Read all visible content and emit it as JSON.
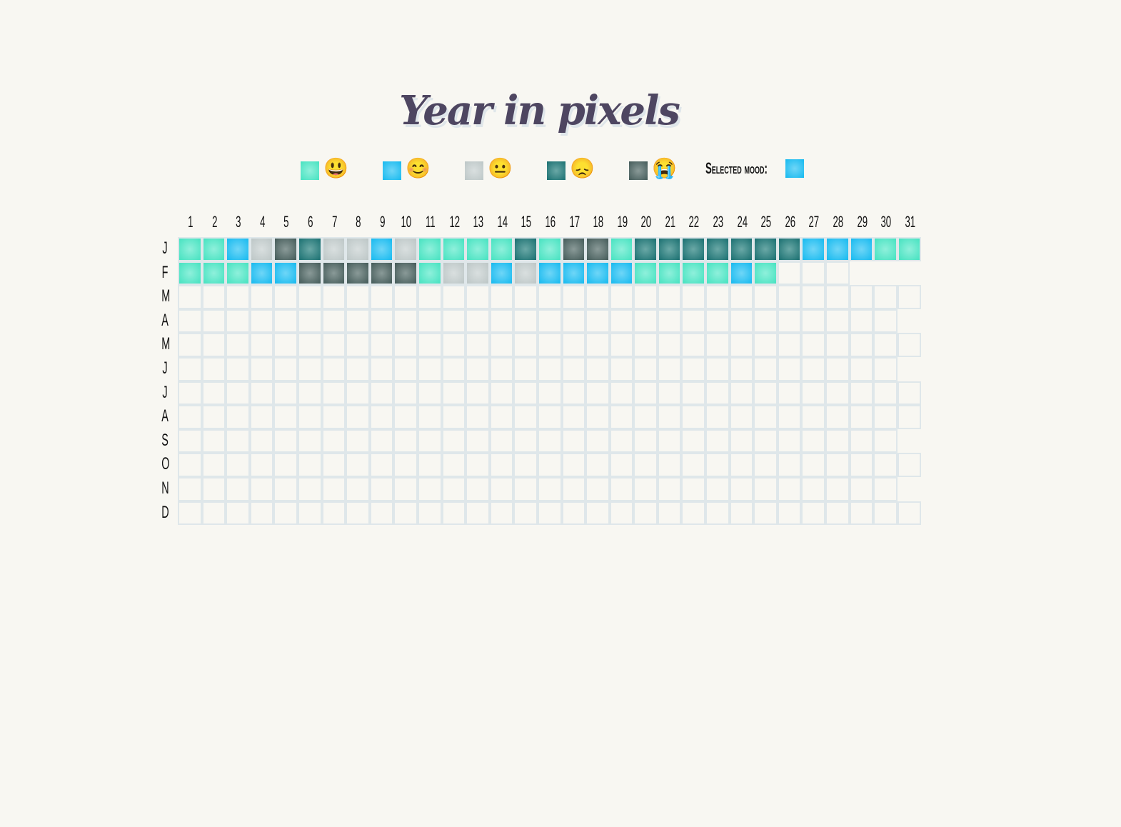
{
  "title": "Year in pixels",
  "moods": [
    {
      "id": 1,
      "emoji": "😃",
      "name": "grinning-face-icon",
      "color": "#45e2c0"
    },
    {
      "id": 2,
      "emoji": "😊",
      "name": "smiling-face-icon",
      "color": "#15b9ef"
    },
    {
      "id": 3,
      "emoji": "😐",
      "name": "neutral-face-icon",
      "color": "#bcc6c6"
    },
    {
      "id": 4,
      "emoji": "😞",
      "name": "disappointed-face-icon",
      "color": "#196f70"
    },
    {
      "id": 5,
      "emoji": "😭",
      "name": "crying-face-icon",
      "color": "#435a58"
    }
  ],
  "selected": {
    "label": "Selected mood:",
    "mood": 2
  },
  "day_labels": [
    "1",
    "2",
    "3",
    "4",
    "5",
    "6",
    "7",
    "8",
    "9",
    "10",
    "11",
    "12",
    "13",
    "14",
    "15",
    "16",
    "17",
    "18",
    "19",
    "20",
    "21",
    "22",
    "23",
    "24",
    "25",
    "26",
    "27",
    "28",
    "29",
    "30",
    "31"
  ],
  "months": [
    {
      "label": "J",
      "days": 31,
      "moods": [
        1,
        1,
        2,
        3,
        5,
        4,
        3,
        3,
        2,
        3,
        1,
        1,
        1,
        1,
        4,
        1,
        5,
        5,
        1,
        4,
        4,
        4,
        4,
        4,
        4,
        4,
        2,
        2,
        2,
        1,
        1
      ]
    },
    {
      "label": "F",
      "days": 28,
      "moods": [
        1,
        1,
        1,
        2,
        2,
        5,
        5,
        5,
        5,
        5,
        1,
        3,
        3,
        2,
        3,
        2,
        2,
        2,
        2,
        1,
        1,
        1,
        1,
        2,
        1
      ]
    },
    {
      "label": "M",
      "days": 31,
      "moods": []
    },
    {
      "label": "A",
      "days": 30,
      "moods": []
    },
    {
      "label": "M",
      "days": 31,
      "moods": []
    },
    {
      "label": "J",
      "days": 30,
      "moods": []
    },
    {
      "label": "J",
      "days": 31,
      "moods": []
    },
    {
      "label": "A",
      "days": 31,
      "moods": []
    },
    {
      "label": "S",
      "days": 30,
      "moods": []
    },
    {
      "label": "O",
      "days": 31,
      "moods": []
    },
    {
      "label": "N",
      "days": 30,
      "moods": []
    },
    {
      "label": "D",
      "days": 31,
      "moods": []
    }
  ]
}
